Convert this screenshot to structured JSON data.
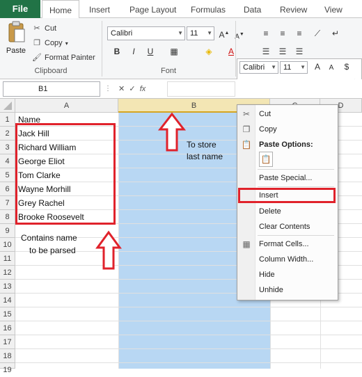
{
  "ribbon": {
    "tabs": [
      "File",
      "Home",
      "Insert",
      "Page Layout",
      "Formulas",
      "Data",
      "Review",
      "View"
    ],
    "clipboard": {
      "paste_label": "Paste",
      "cut_label": "Cut",
      "copy_label": "Copy",
      "format_painter_label": "Format Painter",
      "group_label": "Clipboard"
    },
    "font": {
      "name": "Calibri",
      "size": "11",
      "group_label": "Font"
    },
    "mini_toolbar": {
      "font": "Calibri",
      "size": "11"
    }
  },
  "formula_bar": {
    "name_box": "B1",
    "fx": "fx",
    "formula": ""
  },
  "grid": {
    "columns": [
      "A",
      "B",
      "C",
      "D"
    ],
    "rows": [
      "1",
      "2",
      "3",
      "4",
      "5",
      "6",
      "7",
      "8",
      "9",
      "10",
      "11",
      "12",
      "13",
      "14",
      "15",
      "16",
      "17",
      "18",
      "19"
    ],
    "cells_a": [
      "Name",
      "Jack Hill",
      "Richard William",
      "George Eliot",
      "Tom Clarke",
      "Wayne Morhill",
      "Grey Rachel",
      "Brooke Roosevelt"
    ],
    "notes": {
      "contains": "Contains name",
      "to_be_parsed": "to be parsed",
      "to_store": "To store",
      "last_name": "last name"
    }
  },
  "context_menu": {
    "cut": "Cut",
    "copy": "Copy",
    "paste_options": "Paste Options:",
    "paste_special": "Paste Special...",
    "insert": "Insert",
    "delete": "Delete",
    "clear_contents": "Clear Contents",
    "format_cells": "Format Cells...",
    "column_width": "Column Width...",
    "hide": "Hide",
    "unhide": "Unhide"
  },
  "colors": {
    "highlight_red": "#e0222b",
    "selected_column": "#b8d7f3",
    "excel_green": "#217346"
  }
}
